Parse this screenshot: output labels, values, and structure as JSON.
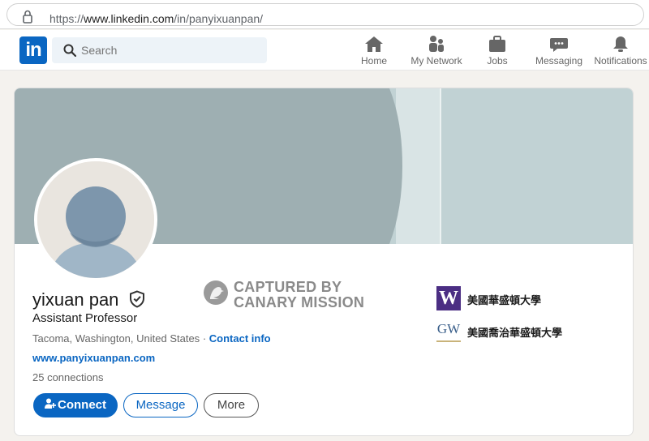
{
  "browser": {
    "url_scheme": "https://",
    "url_host": "www.linkedin.com",
    "url_path": "/in/panyixuanpan/"
  },
  "nav": {
    "logo_text": "in",
    "search_placeholder": "Search",
    "items": [
      {
        "label": "Home",
        "icon": "home-icon"
      },
      {
        "label": "My Network",
        "icon": "network-icon"
      },
      {
        "label": "Jobs",
        "icon": "briefcase-icon"
      },
      {
        "label": "Messaging",
        "icon": "messaging-icon"
      },
      {
        "label": "Notifications",
        "icon": "bell-icon"
      }
    ]
  },
  "profile": {
    "name": "yixuan pan",
    "headline": "Assistant Professor",
    "location": "Tacoma, Washington, United States",
    "separator": "·",
    "contact_info_label": "Contact info",
    "website": "www.panyixuanpan.com",
    "connections": "25 connections",
    "buttons": {
      "connect": "Connect",
      "message": "Message",
      "more": "More"
    }
  },
  "watermark": {
    "line1": "CAPTURED BY",
    "line2": "CANARY MISSION"
  },
  "education": [
    {
      "logo_text": "W",
      "name": "美國華盛頓大學"
    },
    {
      "logo_text": "GW",
      "name": "美國喬治華盛頓大學"
    }
  ],
  "colors": {
    "brand": "#0a66c2",
    "banner_dark": "#9eafb2",
    "banner_light": "#c1d2d4",
    "uw_purple": "#4b2e83"
  }
}
